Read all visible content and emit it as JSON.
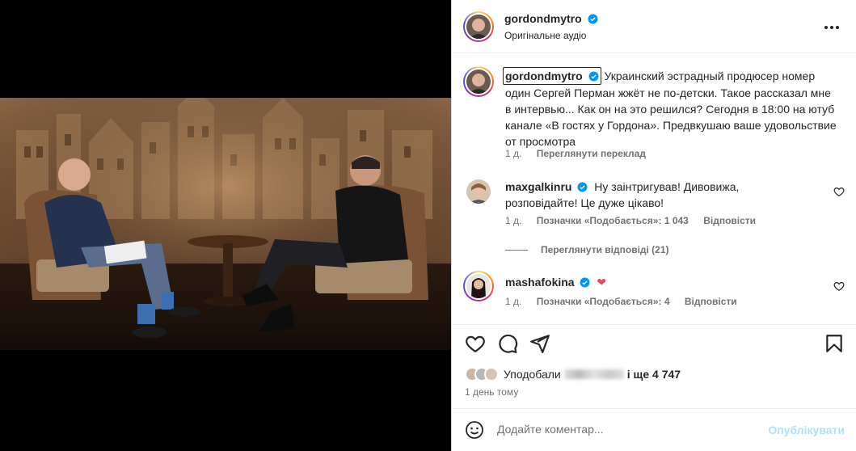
{
  "post": {
    "author": "gordondmytro",
    "audio": "Оригінальне аудіо",
    "caption": "Украинский эстрадный продюсер номер один Сергей Перман жжёт не по-детски. Такое рассказал мне в интервью... Как он на это решился? Сегодня в 18:00 на ютуб канале «В гостях у Гордона». Предвкушаю ваше удовольствие от просмотра",
    "caption_time": "1 д.",
    "see_translation": "Переглянути переклад"
  },
  "comments": [
    {
      "user": "maxgalkinru",
      "text": "Ну заінтригував! Дивовижа, розповідайте! Це дуже цікаво!",
      "time": "1 д.",
      "likes": "Позначки «Подобається»: 1 043",
      "reply": "Відповісти",
      "view_replies": "Переглянути відповіді (21)"
    },
    {
      "user": "mashafokina",
      "text": "❤",
      "time": "1 д.",
      "likes": "Позначки «Подобається»: 4",
      "reply": "Відповісти"
    }
  ],
  "likes_summary": {
    "prefix": "Уподобали",
    "suffix": "і ще 4 747"
  },
  "post_time": "1 день тому",
  "add_comment": {
    "placeholder": "Додайте коментар...",
    "publish": "Опублікувати"
  },
  "colors": {
    "link_blue": "#0095f6",
    "publish_disabled": "#b2dffc",
    "heart_red": "#ed4956",
    "secondary_text": "#737373"
  },
  "icons": [
    "verified-icon",
    "more-icon",
    "heart-icon",
    "comment-icon",
    "share-icon",
    "bookmark-icon",
    "emoji-icon",
    "audio-icon"
  ]
}
